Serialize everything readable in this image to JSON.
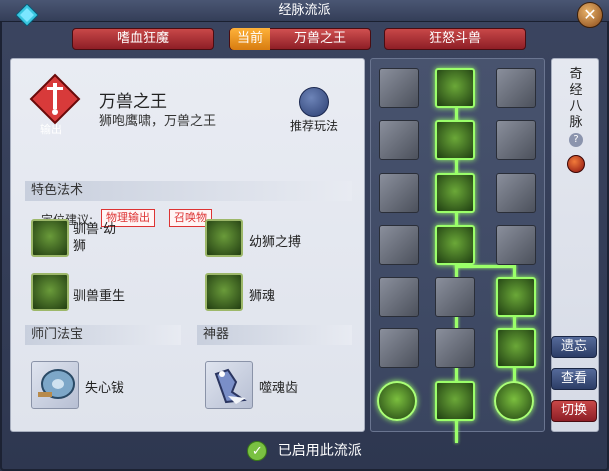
{
  "window": {
    "title": "经脉流派",
    "close_icon": "close-icon"
  },
  "tabs": [
    {
      "label": "嗜血狂魔",
      "active": false
    },
    {
      "current_badge": "当前",
      "label": "万兽之王",
      "active": true
    },
    {
      "label": "狂怒斗兽",
      "active": false
    }
  ],
  "school": {
    "name": "万兽之王",
    "desc": "狮咆鹰啸，万兽之王",
    "badge": "输出",
    "guide_label": "推荐玩法",
    "position_label": "定位建议:",
    "tags": [
      "物理输出",
      "召唤物"
    ]
  },
  "sections": {
    "special": "特色法术",
    "treasure": "师门法宝",
    "artifact": "神器"
  },
  "skills": [
    {
      "label": "驯兽·幼\n狮",
      "icon": "lion-cub-icon"
    },
    {
      "label": "幼狮之搏",
      "icon": "lion-strike-icon"
    },
    {
      "label": "驯兽重生",
      "icon": "lion-rebirth-icon"
    },
    {
      "label": "狮魂",
      "icon": "lion-soul-icon"
    }
  ],
  "items": [
    {
      "label": "失心钹",
      "icon": "cymbal-icon"
    },
    {
      "label": "噬魂齿",
      "icon": "soul-fang-icon"
    }
  ],
  "side": {
    "title": "奇经八脉",
    "help_icon": "question-icon",
    "gem_icon": "red-gem-icon"
  },
  "buttons": {
    "forget": "遗忘",
    "view": "查看",
    "switch": "切换"
  },
  "footer": {
    "status": "已启用此流派"
  }
}
